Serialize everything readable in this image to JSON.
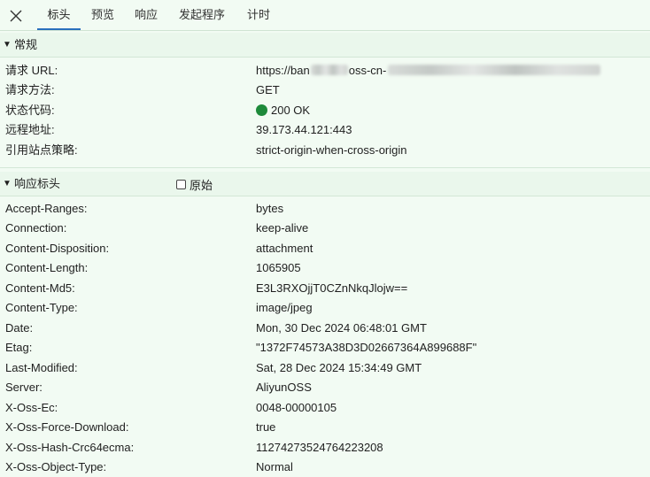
{
  "tabs": [
    {
      "label": "标头",
      "active": true
    },
    {
      "label": "预览",
      "active": false
    },
    {
      "label": "响应",
      "active": false
    },
    {
      "label": "发起程序",
      "active": false
    },
    {
      "label": "计时",
      "active": false
    }
  ],
  "general": {
    "title": "常规",
    "rows": [
      {
        "key": "请求 URL:",
        "value": "https://ban",
        "value_tail": "oss-cn-"
      },
      {
        "key": "请求方法:",
        "value": "GET"
      },
      {
        "key": "状态代码:",
        "value": "200 OK",
        "status_color": "#1e8a3a"
      },
      {
        "key": "远程地址:",
        "value": "39.173.44.121:443"
      },
      {
        "key": "引用站点策略:",
        "value": "strict-origin-when-cross-origin"
      }
    ]
  },
  "response_headers": {
    "title": "响应标头",
    "raw_label": "原始",
    "raw_checked": false,
    "rows": [
      {
        "key": "Accept-Ranges:",
        "value": "bytes"
      },
      {
        "key": "Connection:",
        "value": "keep-alive"
      },
      {
        "key": "Content-Disposition:",
        "value": "attachment"
      },
      {
        "key": "Content-Length:",
        "value": "1065905"
      },
      {
        "key": "Content-Md5:",
        "value": "E3L3RXOjjT0CZnNkqJlojw=="
      },
      {
        "key": "Content-Type:",
        "value": "image/jpeg"
      },
      {
        "key": "Date:",
        "value": "Mon, 30 Dec 2024 06:48:01 GMT"
      },
      {
        "key": "Etag:",
        "value": "\"1372F74573A38D3D02667364A899688F\""
      },
      {
        "key": "Last-Modified:",
        "value": "Sat, 28 Dec 2024 15:34:49 GMT"
      },
      {
        "key": "Server:",
        "value": "AliyunOSS"
      },
      {
        "key": "X-Oss-Ec:",
        "value": "0048-00000105"
      },
      {
        "key": "X-Oss-Force-Download:",
        "value": "true"
      },
      {
        "key": "X-Oss-Hash-Crc64ecma:",
        "value": "11274273524764223208"
      },
      {
        "key": "X-Oss-Object-Type:",
        "value": "Normal"
      }
    ]
  },
  "colors": {
    "background": "#f2fbf3",
    "accent": "#2a6fbd",
    "status_ok": "#1e8a3a"
  }
}
